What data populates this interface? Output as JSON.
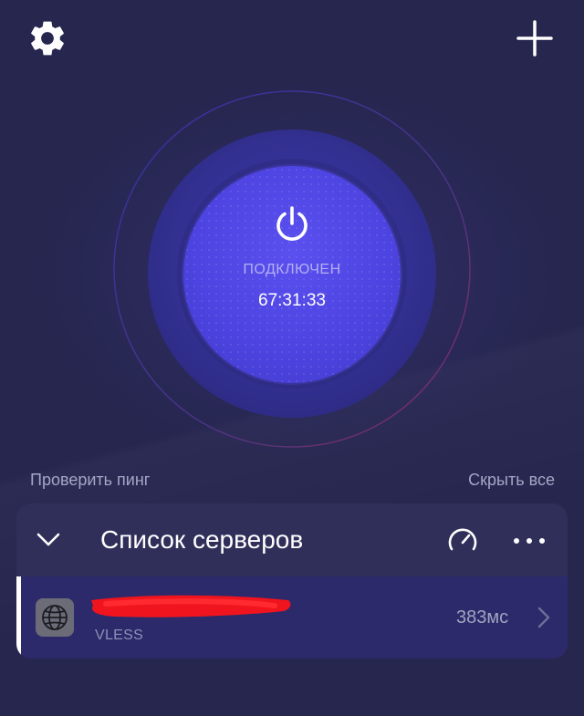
{
  "header": {
    "settings_icon": "gear-icon",
    "add_icon": "plus-icon"
  },
  "connection": {
    "status": "ПОДКЛЮЧЕН",
    "timer": "67:31:33",
    "power_icon": "power-icon",
    "accent_color": "#4e46e5"
  },
  "actions": {
    "check_ping": "Проверить пинг",
    "hide_all": "Скрыть все"
  },
  "server_list": {
    "title": "Список серверов",
    "collapse_icon": "chevron-down-icon",
    "speedtest_icon": "speedometer-icon",
    "more_icon": "more-dots-icon",
    "servers": [
      {
        "name": "",
        "name_redacted": true,
        "protocol": "VLESS",
        "ping": "383мс",
        "icon": "globe-icon",
        "selected": true
      }
    ]
  }
}
